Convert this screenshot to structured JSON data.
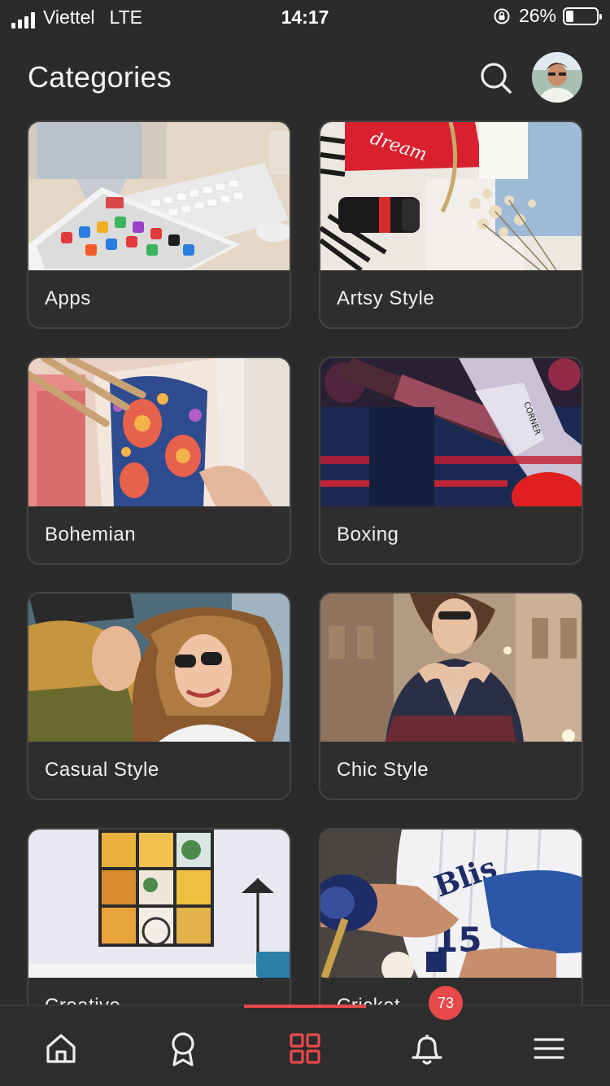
{
  "status_bar": {
    "carrier": "Viettel",
    "network": "LTE",
    "time": "14:17",
    "battery_percent": "26%",
    "battery_level": 0.26
  },
  "header": {
    "title": "Categories",
    "search_icon": "search-icon",
    "avatar": "user-avatar"
  },
  "categories": [
    {
      "label": "Apps"
    },
    {
      "label": "Artsy Style"
    },
    {
      "label": "Bohemian"
    },
    {
      "label": "Boxing"
    },
    {
      "label": "Casual Style"
    },
    {
      "label": "Chic Style"
    },
    {
      "label": "Creative"
    },
    {
      "label": "Cricket"
    }
  ],
  "tabbar": {
    "tabs": [
      {
        "icon": "home-icon"
      },
      {
        "icon": "badge-icon"
      },
      {
        "icon": "grid-icon",
        "active": true
      },
      {
        "icon": "bell-icon"
      },
      {
        "icon": "menu-icon"
      }
    ],
    "notification_count": "73"
  },
  "colors": {
    "background": "#2b2b2b",
    "accent": "#e84a4a",
    "card_border": "#444444"
  }
}
